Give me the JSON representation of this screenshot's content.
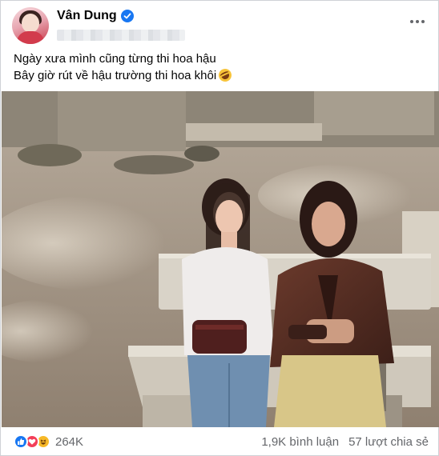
{
  "post": {
    "author_name": "Vân Dung",
    "caption_lines": [
      "Ngày xưa mình cũng từng thi hoa hậu",
      "Bây giờ rút về hậu trường thi hoa khôi"
    ],
    "caption_trailing_emoji": "rolling-on-floor-laughing-emoji"
  },
  "engagement": {
    "reactions_count": "264K",
    "comments": "1,9K bình luận",
    "shares": "57 lượt chia sẻ",
    "reaction_icons": [
      "like-icon",
      "love-icon",
      "haha-icon"
    ]
  },
  "colors": {
    "verified_badge": "#1877f2",
    "like": "#1877f2",
    "love": "#f33e58",
    "haha": "#f7b928",
    "secondary_text": "#65676b"
  }
}
